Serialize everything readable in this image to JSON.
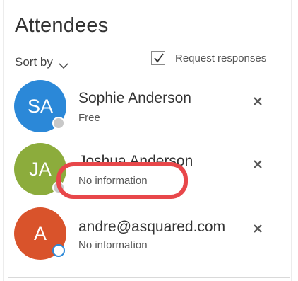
{
  "header": {
    "title": "Attendees",
    "sort_label": "Sort by",
    "request_responses_label": "Request responses",
    "request_responses_checked": true
  },
  "attendees": [
    {
      "initials": "SA",
      "name": "Sophie Anderson",
      "status": "Free",
      "avatar_color": "#2b88d8",
      "presence_color": "#c8c8c8"
    },
    {
      "initials": "JA",
      "name": "Joshua Anderson",
      "status": "No information",
      "avatar_color": "#8cac3c",
      "presence_color": "#c8c8c8"
    },
    {
      "initials": "A",
      "name": "andre@asquared.com",
      "status": "No information",
      "avatar_color": "#d9532b",
      "presence_color": "#ffffff"
    }
  ],
  "colors": {
    "highlight": "#e8474a",
    "remove_icon": "#555555"
  }
}
